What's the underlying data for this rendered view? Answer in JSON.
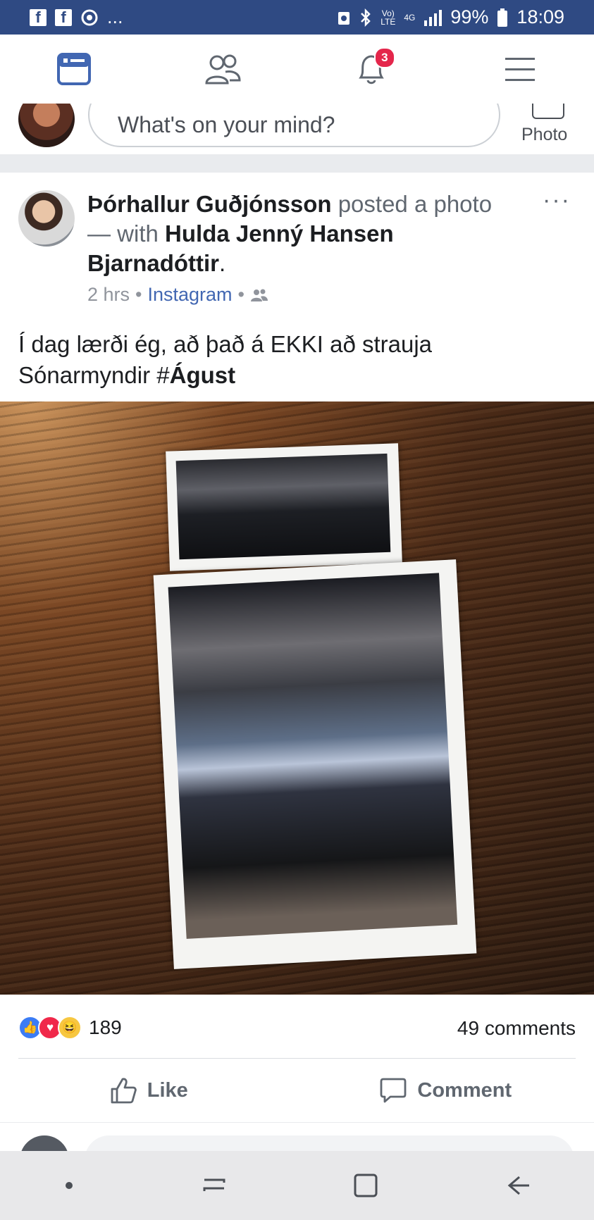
{
  "status_bar": {
    "left_app_icons": [
      "facebook-icon",
      "facebook-icon",
      "sync-icon"
    ],
    "ellipsis": "...",
    "volte_top": "Vo)",
    "volte_bottom": "LTE",
    "network": "4G",
    "battery": "99%",
    "time": "18:09"
  },
  "nav": {
    "items": [
      "news-feed-icon",
      "friends-icon",
      "notifications-icon",
      "menu-icon"
    ],
    "notification_badge": "3",
    "accent_color": "#4267b2"
  },
  "composer": {
    "placeholder": "What's on your mind?",
    "photo_label": "Photo"
  },
  "post": {
    "author": "Þórhallur Guðjónsson",
    "action_text": "posted a photo",
    "with_text": "— with",
    "tagged": "Hulda Jenný Hansen Bjarnadóttir",
    "period": ".",
    "time": "2 hrs",
    "source": "Instagram",
    "dot": "•",
    "audience_icon": "friends-audience-icon",
    "more_label": "···",
    "text_line1": "Í dag lærði ég, að það á EKKI að strauja",
    "text_line2_prefix": "Sónarmyndir #",
    "text_line2_bold": "Águst"
  },
  "engagement": {
    "reactions": [
      "like-reaction-icon",
      "love-reaction-icon",
      "haha-reaction-icon"
    ],
    "reaction_count": "189",
    "comments": "49 comments",
    "like_label": "Like",
    "comment_label": "Comment"
  },
  "system_nav": [
    "dot-icon",
    "recent-apps-icon",
    "home-icon",
    "back-icon"
  ]
}
